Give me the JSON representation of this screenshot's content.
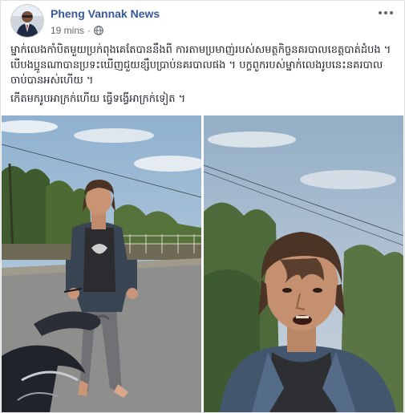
{
  "post": {
    "page_name": "Pheng Vannak News",
    "timestamp": "19 mins",
    "separator": "·",
    "privacy_icon": "globe-icon",
    "more_icon": "more-options-icon",
    "paragraphs": [
      "ម្នាក់លេងកាំបិតមួយប្រក់ពុងគេតែបាននឹងពី ការតាមប្រមាញ់របស់សមត្ថកិច្ចនគរបាលខេត្តបាត់ដំបង ។ បើបងប្អូនណាបានប្រទះឃើញជួយខ្សឹបប្រាប់នគរបាលផង ។ បក្ខពួករបស់ម្នាក់លេងរូបនេះនគរបាលចាប់បានអស់ហើយ ។",
      "កើតមករូបអាក្រក់ហើយ ធ្វើទង្វើអាក្រក់ទៀត ។"
    ]
  },
  "photos": [
    {
      "subject": "man-walking-on-road-photo"
    },
    {
      "subject": "man-closeup-photo"
    }
  ],
  "colors": {
    "link": "#365899",
    "meta": "#616770",
    "text": "#1d2129",
    "background": "#e9ebee"
  }
}
